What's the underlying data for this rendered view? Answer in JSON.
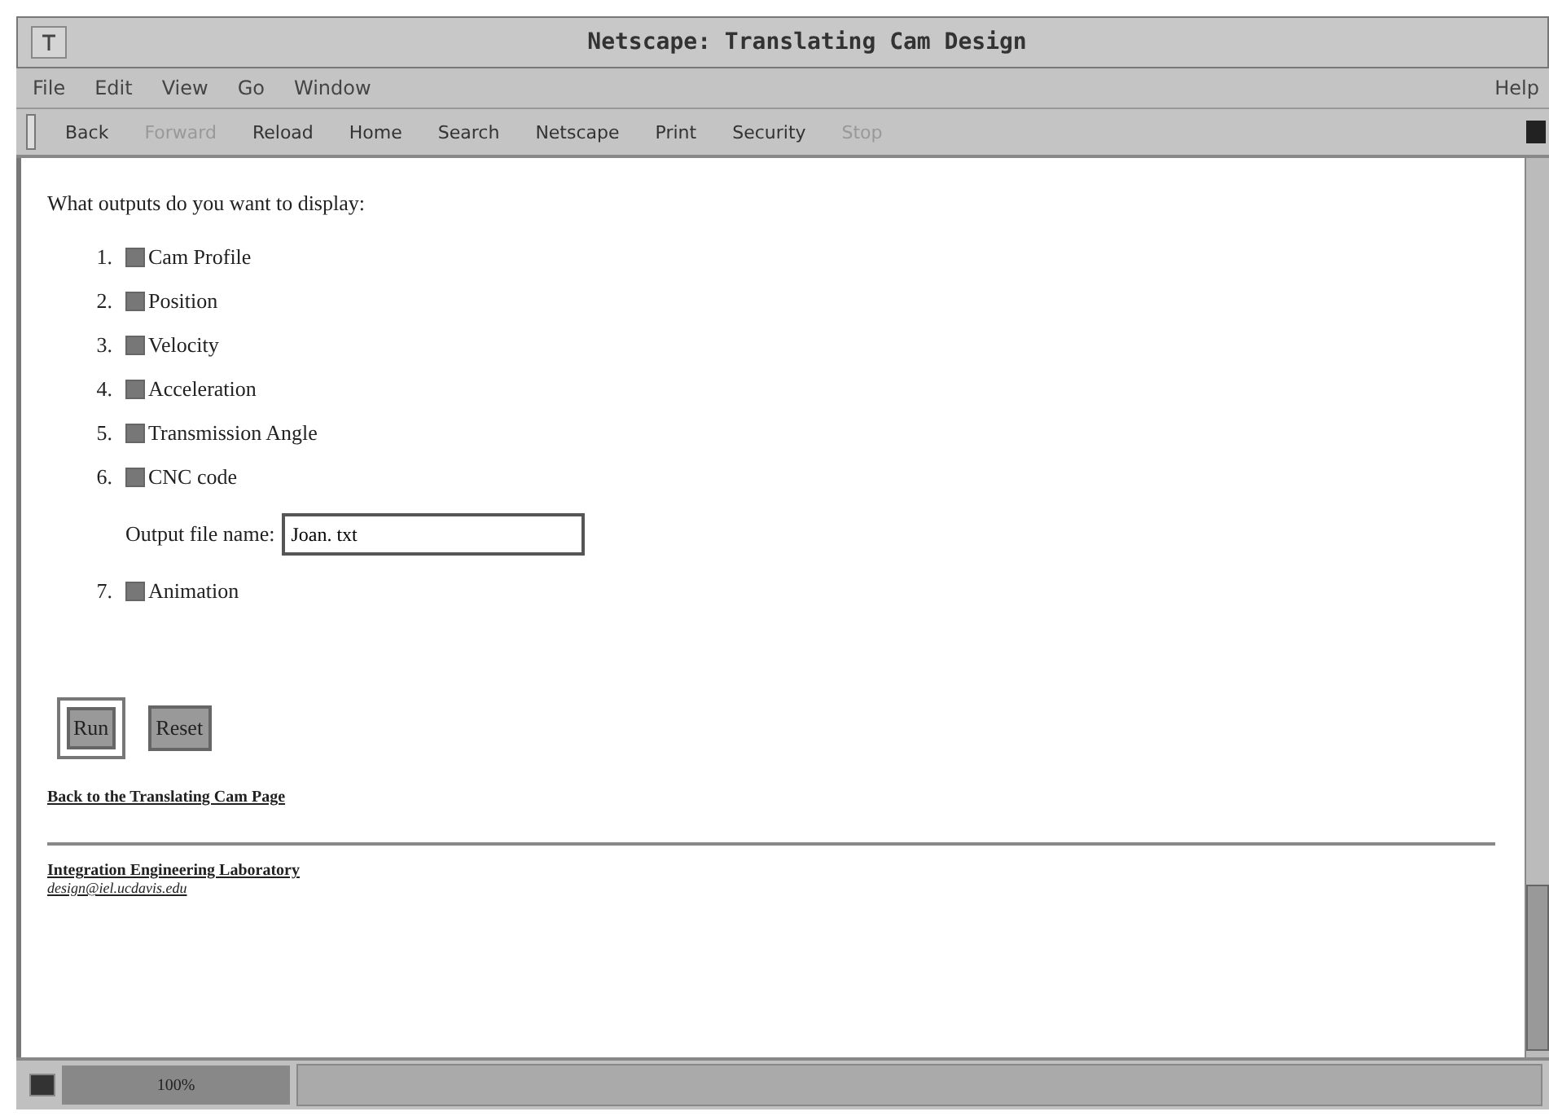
{
  "window": {
    "title": "Netscape: Translating Cam Design"
  },
  "menu": [
    "File",
    "Edit",
    "View",
    "Go",
    "Window"
  ],
  "help_menu": "Help",
  "toolbar": [
    {
      "label": "Back",
      "disabled": false
    },
    {
      "label": "Forward",
      "disabled": true
    },
    {
      "label": "Reload",
      "disabled": false
    },
    {
      "label": "Home",
      "disabled": false
    },
    {
      "label": "Search",
      "disabled": false
    },
    {
      "label": "Netscape",
      "disabled": false
    },
    {
      "label": "Print",
      "disabled": false
    },
    {
      "label": "Security",
      "disabled": false
    },
    {
      "label": "Stop",
      "disabled": true
    }
  ],
  "question": "What outputs do you want to display:",
  "outputs": [
    {
      "number": "1.",
      "label": "Cam Profile",
      "checked": true
    },
    {
      "number": "2.",
      "label": "Position",
      "checked": true
    },
    {
      "number": "3.",
      "label": "Velocity",
      "checked": true
    },
    {
      "number": "4.",
      "label": "Acceleration",
      "checked": true
    },
    {
      "number": "5.",
      "label": "Transmission Angle",
      "checked": true
    },
    {
      "number": "6.",
      "label": "CNC code",
      "checked": true,
      "field": {
        "label": "Output file name:",
        "value": "Joan. txt"
      }
    },
    {
      "number": "7.",
      "label": "Animation",
      "checked": true
    }
  ],
  "buttons": [
    {
      "label": "Run",
      "selected": true
    },
    {
      "label": "Reset",
      "selected": false
    }
  ],
  "back_link": "Back to the Translating Cam Page",
  "footer": {
    "lab": "Integration Engineering Laboratory",
    "email": "design@iel.ucdavis.edu"
  },
  "status_bar": {
    "progress": "100%"
  }
}
